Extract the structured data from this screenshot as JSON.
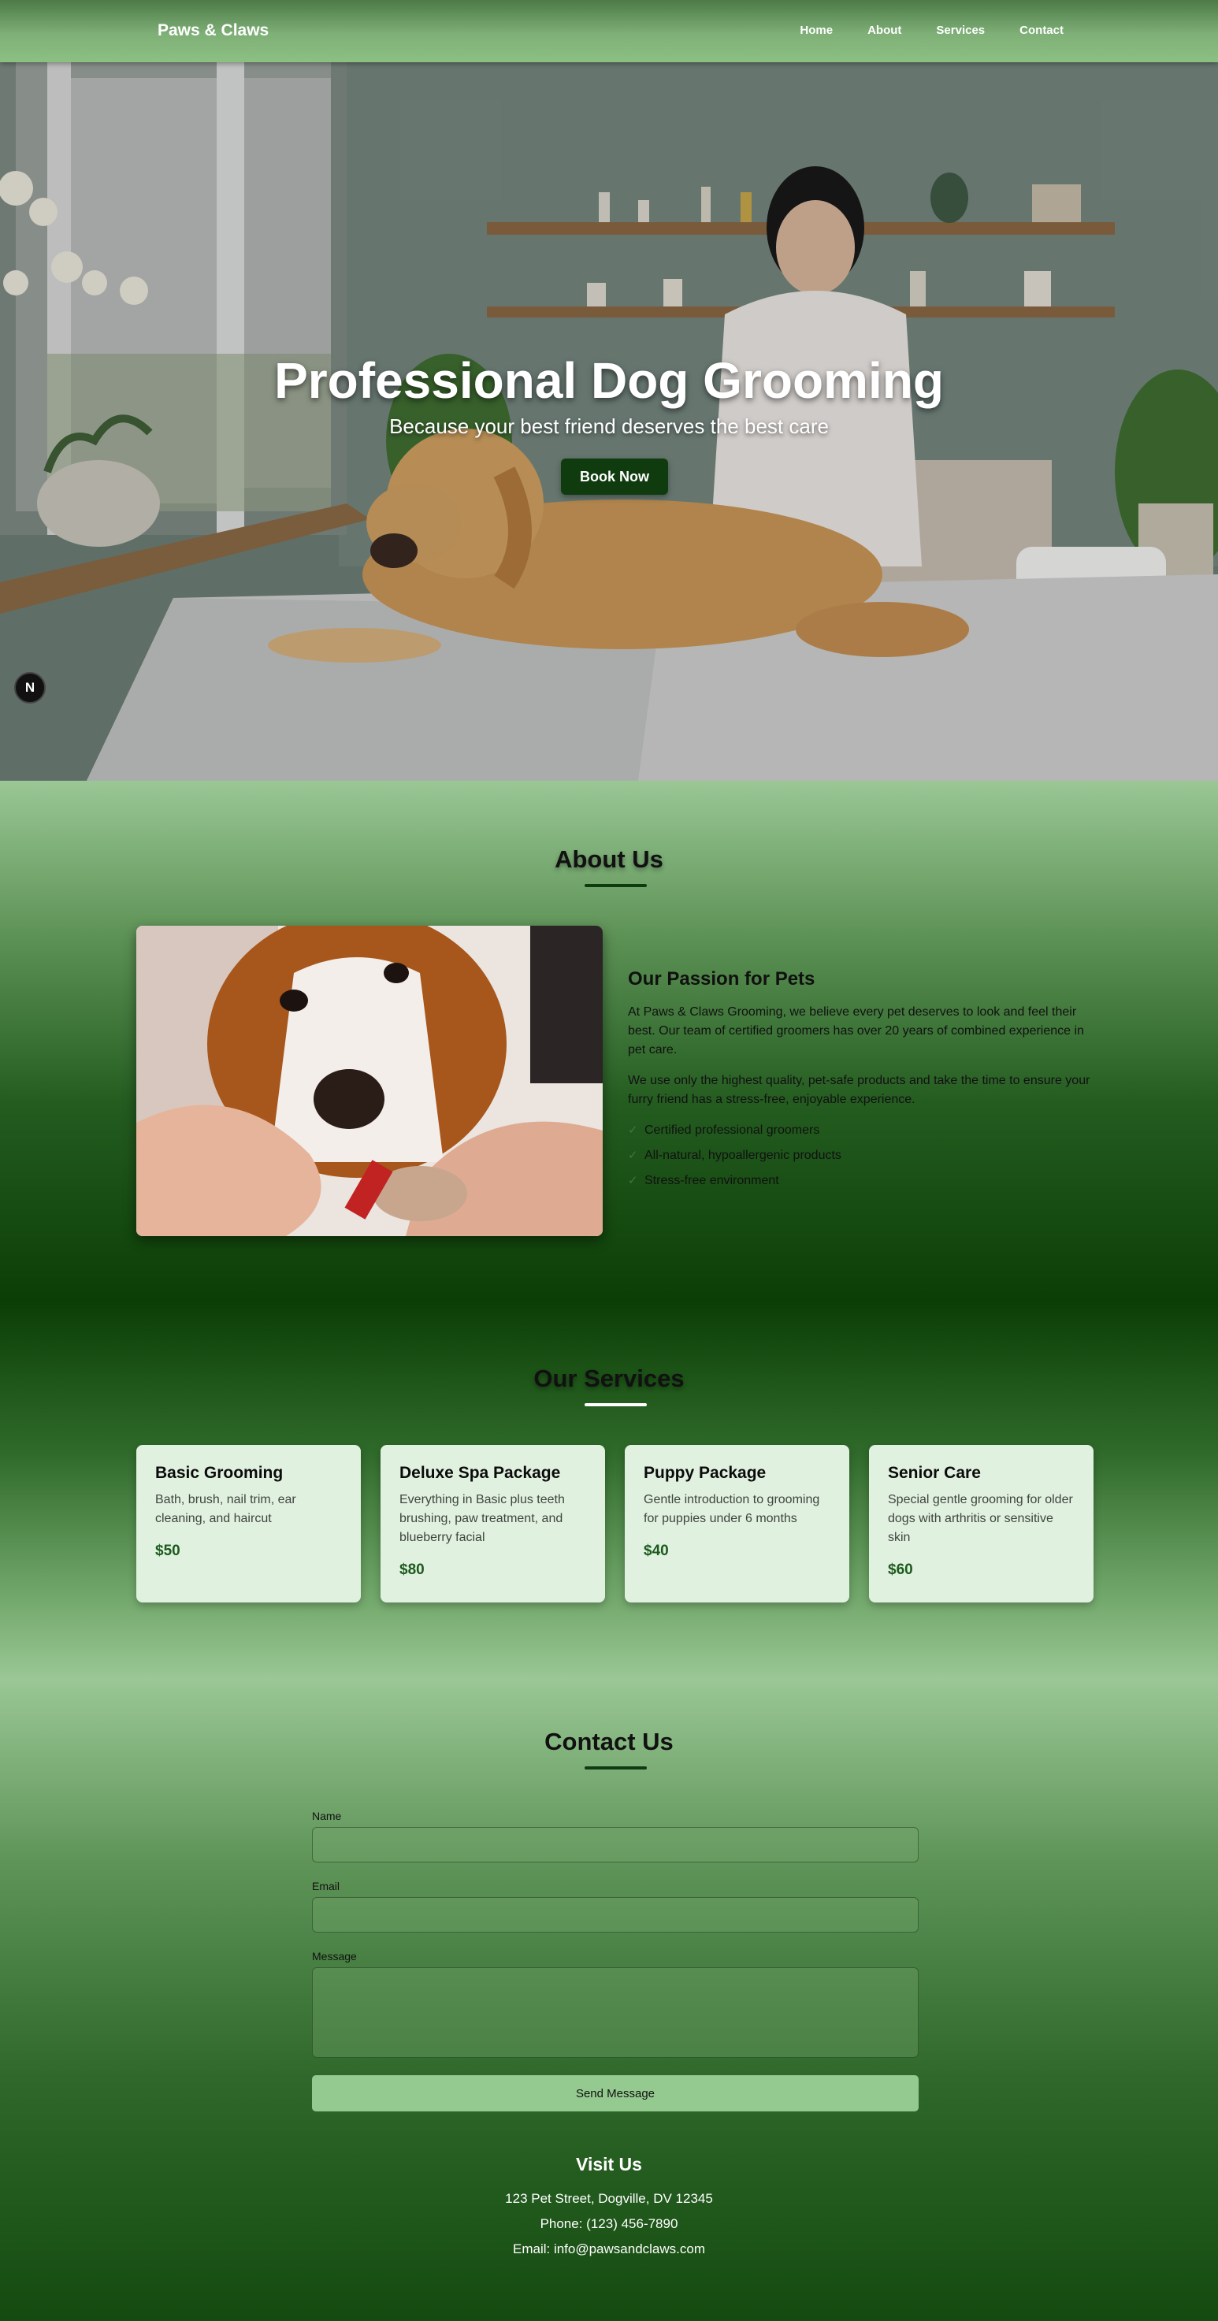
{
  "nav": {
    "brand": "Paws & Claws",
    "links": [
      "Home",
      "About",
      "Services",
      "Contact"
    ]
  },
  "hero": {
    "title": "Professional Dog Grooming",
    "subtitle": "Because your best friend deserves the best care",
    "cta": "Book Now",
    "badge": "N"
  },
  "about": {
    "title": "About Us",
    "heading": "Our Passion for Pets",
    "paragraphs": [
      "At Paws & Claws Grooming, we believe every pet deserves to look and feel their best. Our team of certified groomers has over 20 years of combined experience in pet care.",
      "We use only the highest quality, pet-safe products and take the time to ensure your furry friend has a stress-free, enjoyable experience."
    ],
    "features": [
      "Certified professional groomers",
      "All-natural, hypoallergenic products",
      "Stress-free environment"
    ],
    "check_glyph": "✓"
  },
  "services": {
    "title": "Our Services",
    "items": [
      {
        "name": "Basic Grooming",
        "desc": "Bath, brush, nail trim, ear cleaning, and haircut",
        "price": "$50"
      },
      {
        "name": "Deluxe Spa Package",
        "desc": "Everything in Basic plus teeth brushing, paw treatment, and blueberry facial",
        "price": "$80"
      },
      {
        "name": "Puppy Package",
        "desc": "Gentle introduction to grooming for puppies under 6 months",
        "price": "$40"
      },
      {
        "name": "Senior Care",
        "desc": "Special gentle grooming for older dogs with arthritis or sensitive skin",
        "price": "$60"
      }
    ]
  },
  "contact": {
    "title": "Contact Us",
    "name_label": "Name",
    "email_label": "Email",
    "message_label": "Message",
    "submit": "Send Message",
    "visit_title": "Visit Us",
    "address": "123 Pet Street, Dogville, DV 12345",
    "phone": "Phone: (123) 456-7890",
    "email": "Email: info@pawsandclaws.com"
  },
  "colors": {
    "nav_green": "#7fb077",
    "dark_green": "#0b3e05",
    "card_bg": "#e1f1e0",
    "button_dark": "#0f3b0f",
    "button_light": "#94ca8f"
  }
}
